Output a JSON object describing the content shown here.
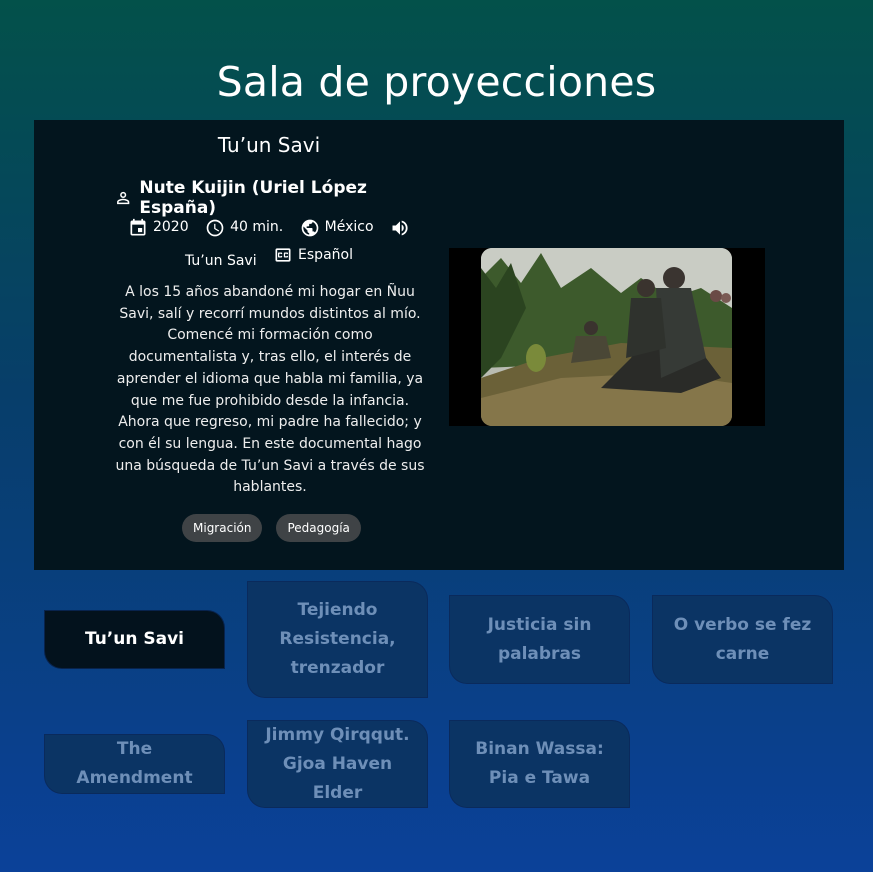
{
  "page": {
    "title": "Sala de proyecciones"
  },
  "film": {
    "title": "Tu’un Savi",
    "director": "Nute Kuijin (Uriel López España)",
    "year": "2020",
    "duration": "40 min.",
    "country": "México",
    "language": "Tu’un Savi",
    "subtitles": "Español",
    "synopsis": "A los 15 años abandoné mi hogar en Ñuu Savi, salí y recorrí mundos distintos al mío. Comencé mi formación como documentalista y, tras ello, el interés de aprender el idioma que habla mi familia, ya que me fue prohibido desde la infancia. Ahora que regreso, mi padre ha fallecido; y con él su lengua. En este documental hago una búsqueda de Tu’un Savi a través de sus hablantes.",
    "tags": [
      "Migración",
      "Pedagogía"
    ],
    "icons": [
      "person-icon",
      "calendar-icon",
      "clock-icon",
      "globe-icon",
      "speaker-icon",
      "closed-captions-icon"
    ]
  },
  "films": [
    {
      "label": "Tu’un Savi",
      "active": true
    },
    {
      "label": "Tejiendo Resistencia, trenzador",
      "active": false
    },
    {
      "label": "Justicia sin palabras",
      "active": false
    },
    {
      "label": "O verbo se fez carne",
      "active": false
    },
    {
      "label": "The Amendment",
      "active": false
    },
    {
      "label": "Jimmy Qirqqut. Gjoa Haven Elder",
      "active": false
    },
    {
      "label": "Binan Wassa: Pia e Tawa",
      "active": false
    }
  ],
  "colors": {
    "panel": "#03151e",
    "card": "#0b3464",
    "card_text": "#6e8fb8",
    "active_card": "#03121d",
    "tag": "#3f4346"
  }
}
